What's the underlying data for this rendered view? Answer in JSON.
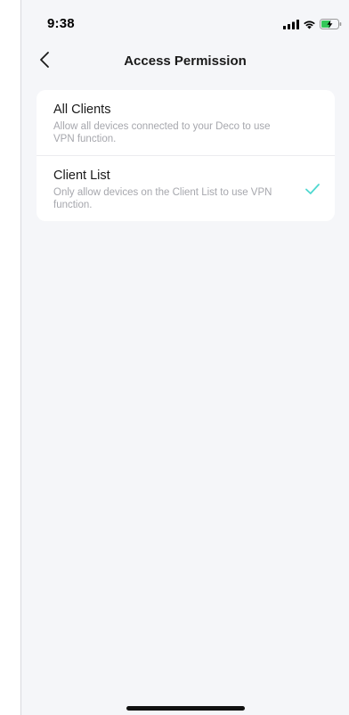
{
  "status_bar": {
    "time": "9:38",
    "icons": [
      "signal-icon",
      "wifi-icon",
      "battery-charging-icon"
    ]
  },
  "nav": {
    "back_icon": "chevron-left-icon",
    "title": "Access Permission"
  },
  "options": [
    {
      "title": "All Clients",
      "description": "Allow all devices connected to your Deco to use VPN function.",
      "selected": false
    },
    {
      "title": "Client List",
      "description": "Only allow devices on the Client List to use VPN function.",
      "selected": true
    }
  ],
  "colors": {
    "accent_check": "#4fd8d0",
    "background": "#f5f6f9",
    "card": "#ffffff",
    "secondary_text": "#a6a7ad"
  }
}
